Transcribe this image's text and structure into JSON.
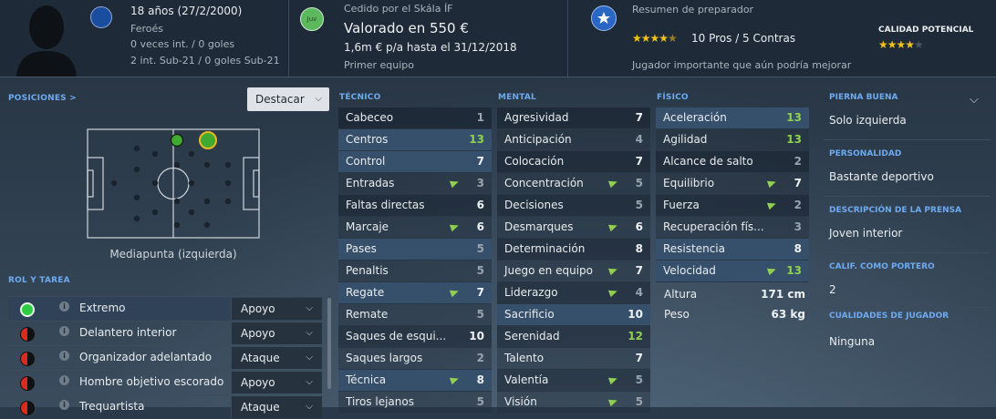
{
  "header": {
    "age": "18 años (27/2/2000)",
    "nationality": "Feroés",
    "caps": "0 veces int. / 0 goles",
    "u21": "2 int. Sub-21 / 0 goles Sub-21",
    "loan": "Cedido por el Skála ÍF",
    "club_badge": "Juv",
    "value": "Valorado en 550 €",
    "contract": "1,6m € p/a hasta el 31/12/2018",
    "squad": "Primer equipo",
    "coach_title": "Resumen de preparador",
    "coach_stars": 4.5,
    "coach_pros": "10 Pros / 5 Contras",
    "coach_summary": "Jugador importante que aún podría mejorar",
    "potential_title": "CALIDAD POTENCIAL",
    "potential_stars": 4
  },
  "positions": {
    "title": "POSICIONES >",
    "highlight_label": "Destacar",
    "position_name": "Mediapunta (izquierda)"
  },
  "roles": {
    "title": "ROL Y TAREA",
    "items": [
      {
        "name": "Extremo",
        "duty": "Apoyo",
        "rating": "green"
      },
      {
        "name": "Delantero interior",
        "duty": "Apoyo",
        "rating": "half-red"
      },
      {
        "name": "Organizador adelantado",
        "duty": "Ataque",
        "rating": "half-red"
      },
      {
        "name": "Hombre objetivo escorado",
        "duty": "Apoyo",
        "rating": "half-red"
      },
      {
        "name": "Trequartista",
        "duty": "Ataque",
        "rating": "half-red"
      }
    ]
  },
  "attributes": {
    "technical_title": "TÉCNICO",
    "mental_title": "MENTAL",
    "physical_title": "FÍSICO",
    "technical": [
      {
        "name": "Cabeceo",
        "value": "1"
      },
      {
        "name": "Centros",
        "value": "13",
        "hl": true
      },
      {
        "name": "Control",
        "value": "7",
        "hl": true
      },
      {
        "name": "Entradas",
        "value": "3",
        "arrow": true
      },
      {
        "name": "Faltas directas",
        "value": "6"
      },
      {
        "name": "Marcaje",
        "value": "6",
        "arrow": true
      },
      {
        "name": "Pases",
        "value": "5",
        "hl": true
      },
      {
        "name": "Penaltis",
        "value": "5"
      },
      {
        "name": "Regate",
        "value": "7",
        "hl": true,
        "arrow": true
      },
      {
        "name": "Remate",
        "value": "5"
      },
      {
        "name": "Saques de esqui...",
        "value": "10"
      },
      {
        "name": "Saques largos",
        "value": "2"
      },
      {
        "name": "Técnica",
        "value": "8",
        "hl": true,
        "arrow": true
      },
      {
        "name": "Tiros lejanos",
        "value": "5"
      }
    ],
    "mental": [
      {
        "name": "Agresividad",
        "value": "7"
      },
      {
        "name": "Anticipación",
        "value": "4"
      },
      {
        "name": "Colocación",
        "value": "7"
      },
      {
        "name": "Concentración",
        "value": "5",
        "arrow": true
      },
      {
        "name": "Decisiones",
        "value": "5"
      },
      {
        "name": "Desmarques",
        "value": "6",
        "arrow": true
      },
      {
        "name": "Determinación",
        "value": "8"
      },
      {
        "name": "Juego en equipo",
        "value": "7",
        "arrow": true
      },
      {
        "name": "Liderazgo",
        "value": "4",
        "arrow": true
      },
      {
        "name": "Sacrificio",
        "value": "10",
        "hl": true
      },
      {
        "name": "Serenidad",
        "value": "12"
      },
      {
        "name": "Talento",
        "value": "7"
      },
      {
        "name": "Valentía",
        "value": "5",
        "arrow": true
      },
      {
        "name": "Visión",
        "value": "5",
        "arrow": true
      }
    ],
    "physical": [
      {
        "name": "Aceleración",
        "value": "13",
        "hl": true
      },
      {
        "name": "Agilidad",
        "value": "13"
      },
      {
        "name": "Alcance de salto",
        "value": "2"
      },
      {
        "name": "Equilibrio",
        "value": "7",
        "arrow": true
      },
      {
        "name": "Fuerza",
        "value": "2",
        "arrow": true
      },
      {
        "name": "Recuperación fís...",
        "value": "3"
      },
      {
        "name": "Resistencia",
        "value": "8",
        "hl": true
      },
      {
        "name": "Velocidad",
        "value": "13",
        "hl": true,
        "arrow": true
      }
    ],
    "height_label": "Altura",
    "height_value": "171 cm",
    "weight_label": "Peso",
    "weight_value": "63 kg"
  },
  "profile": {
    "foot_title": "PIERNA BUENA",
    "foot_value": "Solo izquierda",
    "personality_title": "PERSONALIDAD",
    "personality_value": "Bastante deportivo",
    "press_title": "DESCRIPCIÓN DE LA PRENSA",
    "press_value": "Joven interior",
    "gk_title": "CALIF. COMO PORTERO",
    "gk_value": "2",
    "traits_title": "CUALIDADES DE JUGADOR",
    "traits_value": "Ninguna"
  },
  "colors": {
    "accent": "#6eaaf0",
    "green_value": "#8fd14f",
    "star": "#f2c21b"
  }
}
